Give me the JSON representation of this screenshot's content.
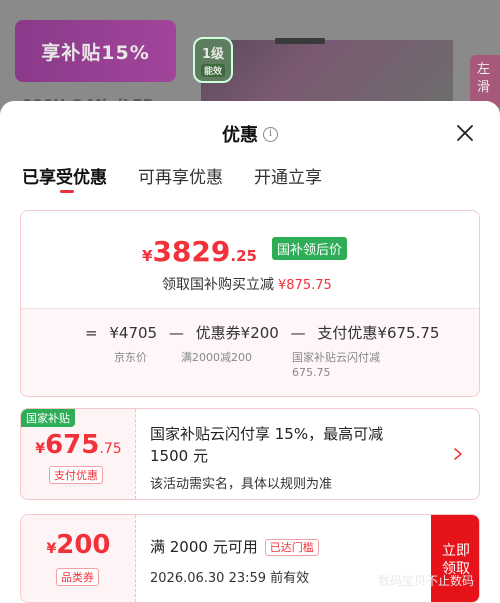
{
  "background": {
    "badge_text": "享补贴15%",
    "energy_level": "1级",
    "energy_sub": "能效",
    "side_text": "左滑",
    "title_partial": "000U C    MiniLED"
  },
  "sheet": {
    "title": "优惠",
    "info_icon": "i"
  },
  "tabs": [
    "已享受优惠",
    "可再享优惠",
    "开通立享"
  ],
  "summary": {
    "final_price": {
      "yen": "¥",
      "int": "3829",
      "dec": ".25"
    },
    "price_tag": "国补领后价",
    "instant_label": "领取国补购买立减",
    "instant_amount": "¥875.75",
    "calc": {
      "eq": "=",
      "base": "¥4705",
      "minus1": "—",
      "coupon_label": "优惠券",
      "coupon_value": "¥200",
      "minus2": "—",
      "pay_label": "支付优惠",
      "pay_value": "¥675.75"
    },
    "sub_base": "京东价",
    "sub_coupon": "满2000减200",
    "sub_pay_line1": "国家补贴云闪付减",
    "sub_pay_line2": "675.75"
  },
  "coupon_pay": {
    "tag": "国家补贴",
    "amount": {
      "yen": "¥",
      "int": "675",
      "dec": ".75"
    },
    "label": "支付优惠",
    "title_line1": "国家补贴云闪付享 15%，最高可减",
    "title_line2": "1500 元",
    "desc": "该活动需实名，具体以规则为准"
  },
  "coupon_item": {
    "amount": {
      "yen": "¥",
      "int": "200"
    },
    "label": "品类券",
    "title": "满 2000 元可用",
    "cond_tag": "已达门槛",
    "valid": "2026.06.30 23:59 前有效",
    "btn_line1": "立即",
    "btn_line2": "领取"
  },
  "watermark": "数码宝贝不止数码",
  "colors": {
    "accent": "#f2323b",
    "green_tag": "#2ead57",
    "claim_button": "#e7131b"
  }
}
